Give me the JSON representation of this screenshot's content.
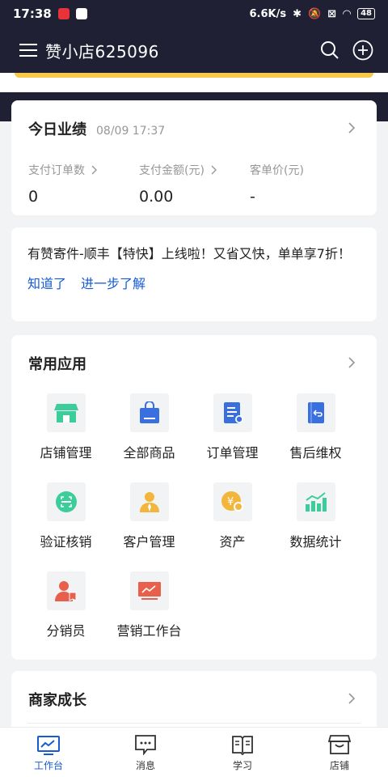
{
  "status_bar": {
    "time": "17:38",
    "net_speed": "6.6K/s",
    "battery": "48"
  },
  "header": {
    "title": "赞小店625096"
  },
  "performance": {
    "title": "今日业绩",
    "datetime": "08/09 17:37",
    "stats": [
      {
        "label": "支付订单数",
        "value": "0",
        "has_arrow": true
      },
      {
        "label": "支付金额(元)",
        "value": "0.00",
        "has_arrow": true
      },
      {
        "label": "客单价(元)",
        "value": "-",
        "has_arrow": false
      }
    ]
  },
  "notice": {
    "message": "有赞寄件-顺丰【特快】上线啦！又省又快，单单享7折！",
    "link_ok": "知道了",
    "link_more": "进一步了解"
  },
  "apps": {
    "title": "常用应用",
    "items": [
      {
        "label": "店铺管理",
        "icon": "store-icon",
        "color": "#3ccd9b"
      },
      {
        "label": "全部商品",
        "icon": "shopping-bag-icon",
        "color": "#3a6fe0"
      },
      {
        "label": "订单管理",
        "icon": "order-document-icon",
        "color": "#3a6fe0"
      },
      {
        "label": "售后维权",
        "icon": "return-book-icon",
        "color": "#3a6fe0"
      },
      {
        "label": "验证核销",
        "icon": "verify-scan-icon",
        "color": "#3ccd9b"
      },
      {
        "label": "客户管理",
        "icon": "customer-icon",
        "color": "#f2b63c"
      },
      {
        "label": "资产",
        "icon": "yuan-coin-icon",
        "color": "#f2b63c"
      },
      {
        "label": "数据统计",
        "icon": "bar-chart-icon",
        "color": "#3ccd9b"
      },
      {
        "label": "分销员",
        "icon": "distributor-icon",
        "color": "#e8604c"
      },
      {
        "label": "营销工作台",
        "icon": "marketing-board-icon",
        "color": "#e8604c"
      }
    ]
  },
  "growth": {
    "title": "商家成长"
  },
  "tabbar": {
    "items": [
      {
        "label": "工作台",
        "icon": "workbench-icon",
        "active": true
      },
      {
        "label": "消息",
        "icon": "message-icon",
        "active": false
      },
      {
        "label": "学习",
        "icon": "book-icon",
        "active": false
      },
      {
        "label": "店铺",
        "icon": "shop-icon",
        "active": false
      }
    ]
  },
  "colors": {
    "header_bg": "#1f2033",
    "accent_blue": "#155bd4",
    "page_bg": "#f2f3f5"
  }
}
